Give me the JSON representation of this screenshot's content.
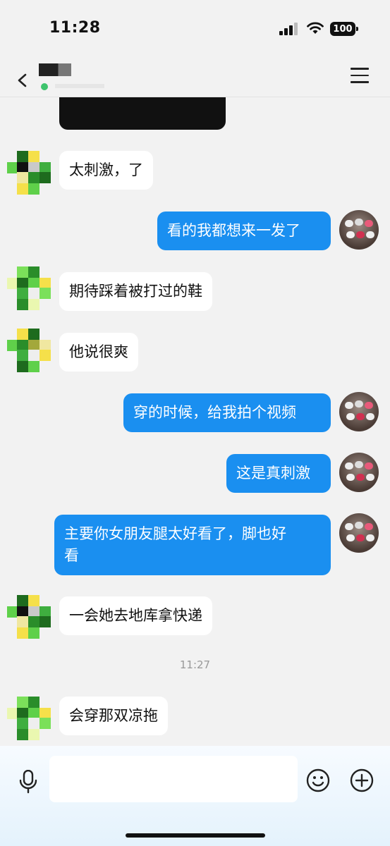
{
  "status_bar": {
    "time": "11:28",
    "battery": "100"
  },
  "header": {
    "back_icon": "back-icon",
    "menu_icon": "menu-icon"
  },
  "messages": [
    {
      "side": "left",
      "text": "太刺激，了"
    },
    {
      "side": "right",
      "text": "看的我都想来一发了"
    },
    {
      "side": "left",
      "text": "期待踩着被打过的鞋"
    },
    {
      "side": "left",
      "text": "他说很爽"
    },
    {
      "side": "right",
      "text": "穿的时候，给我拍个视频"
    },
    {
      "side": "right",
      "text": "这是真刺激"
    },
    {
      "side": "right",
      "text": "主要你女朋友腿太好看了，脚也好\n看"
    },
    {
      "side": "left",
      "text": "一会她去地库拿快递"
    },
    {
      "side": "left",
      "text": "会穿那双凉拖"
    }
  ],
  "timestamp": "11:27",
  "input_bar": {
    "mic_icon": "microphone-icon",
    "placeholder": "",
    "emoji_icon": "emoji-icon",
    "plus_icon": "plus-icon"
  },
  "colors": {
    "sent_bubble": "#1a8ff0",
    "received_bubble": "#ffffff",
    "background": "#f2f2f2"
  }
}
